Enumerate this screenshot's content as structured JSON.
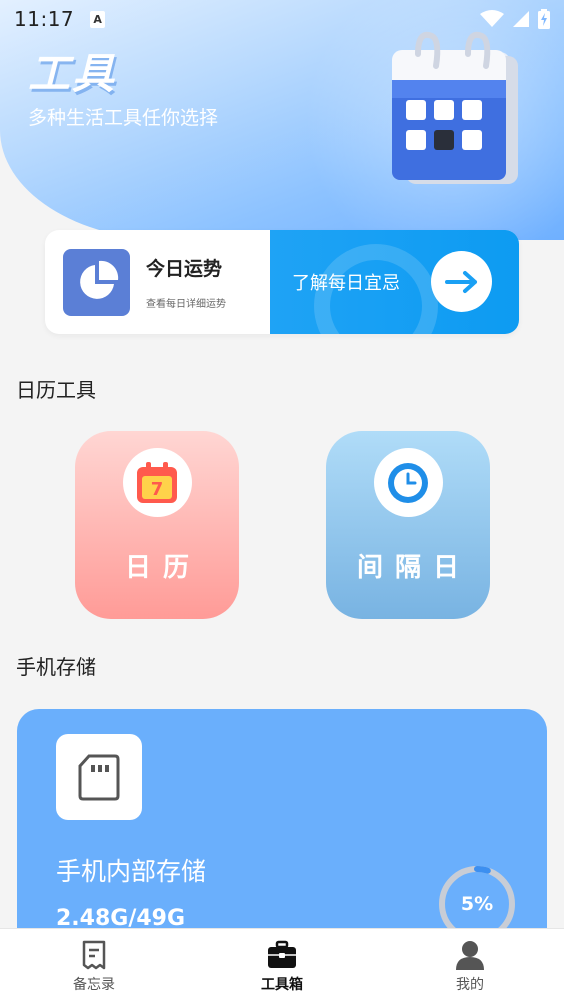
{
  "status_bar": {
    "time": "11:17",
    "notification_icon": "a-letter-icon",
    "icons": [
      "wifi-icon",
      "signal-icon",
      "battery-charging-icon"
    ]
  },
  "header": {
    "title": "工具",
    "subtitle": "多种生活工具任你选择",
    "illustration": "calendar-3d-icon"
  },
  "fortune_banner": {
    "title": "今日运势",
    "description": "查看每日详细运势",
    "link_text": "了解每日宜忌",
    "icon": "pie-chart-icon",
    "button_icon": "arrow-right-icon",
    "accent_color": "#0d9bf2"
  },
  "calendar_tools": {
    "section_title": "日历工具",
    "items": [
      {
        "label": "日历",
        "icon": "calendar-icon",
        "icon_text": "7"
      },
      {
        "label": "间隔日",
        "icon": "clock-icon"
      }
    ]
  },
  "storage": {
    "section_title": "手机存储",
    "title": "手机内部存储",
    "size": "2.48G/49G",
    "percent_text": "5%",
    "percent_value": 0.05,
    "icon": "sd-card-icon"
  },
  "bottom_nav": {
    "items": [
      {
        "label": "备忘录",
        "icon": "memo-icon",
        "active": false
      },
      {
        "label": "工具箱",
        "icon": "toolbox-icon",
        "active": true
      },
      {
        "label": "我的",
        "icon": "person-icon",
        "active": false
      }
    ]
  }
}
